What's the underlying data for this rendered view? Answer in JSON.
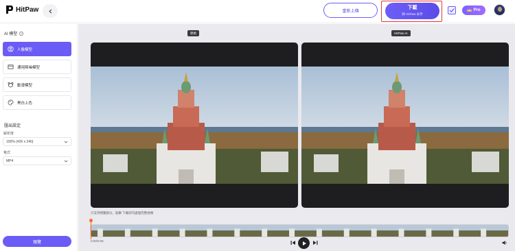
{
  "app": {
    "name": "HitPaw"
  },
  "header": {
    "reupload_label": "重新上傳",
    "download_label": "下載",
    "download_sub": "將 HitPaw 永存",
    "pro_label": "Pro"
  },
  "sidebar": {
    "section_title": "AI 模型",
    "models": [
      {
        "label": "人像模型",
        "icon": "portrait-icon",
        "active": true
      },
      {
        "label": "通用降噪模型",
        "icon": "film-icon",
        "active": false
      },
      {
        "label": "動漫模型",
        "icon": "bear-face-icon",
        "active": false
      },
      {
        "label": "黑白上色",
        "icon": "palette-icon",
        "active": false
      }
    ],
    "export_title": "匯出設定",
    "resolution_label": "解析度",
    "resolution_value": "100% (426 x 240)",
    "format_label": "格式",
    "format_value": "MP4",
    "preview_label": "預覽"
  },
  "main": {
    "original_tag": "原始",
    "ai_tag": "HitPaw AI",
    "hint": "只支持預覽部分，點擊 下載即可處理完整視頻",
    "time": "0:00/0:05"
  },
  "colors": {
    "accent": "#6b5cf6",
    "highlight": "#e03a3a",
    "playhead": "#ff6a2a"
  }
}
